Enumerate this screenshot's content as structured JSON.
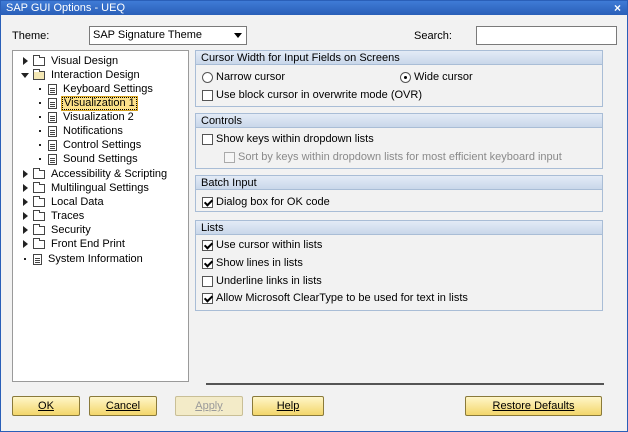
{
  "window": {
    "title": "SAP GUI Options - UEQ",
    "close_glyph": "×"
  },
  "theme": {
    "label": "Theme:",
    "value": "SAP Signature Theme"
  },
  "search": {
    "label": "Search:",
    "value": ""
  },
  "tree": [
    {
      "label": "Visual Design",
      "expander": "right",
      "icon": "folder-icon"
    },
    {
      "label": "Interaction Design",
      "expander": "down",
      "icon": "folder-open-icon"
    },
    {
      "label": "Keyboard Settings",
      "expander": "dot",
      "icon": "page-icon"
    },
    {
      "label": "Visualization 1",
      "expander": "dot",
      "icon": "page-icon",
      "selected": true
    },
    {
      "label": "Visualization 2",
      "expander": "dot",
      "icon": "page-icon"
    },
    {
      "label": "Notifications",
      "expander": "dot",
      "icon": "page-icon"
    },
    {
      "label": "Control Settings",
      "expander": "dot",
      "icon": "page-icon"
    },
    {
      "label": "Sound Settings",
      "expander": "dot",
      "icon": "page-icon"
    },
    {
      "label": "Accessibility & Scripting",
      "expander": "right",
      "icon": "folder-icon"
    },
    {
      "label": "Multilingual Settings",
      "expander": "right",
      "icon": "folder-icon"
    },
    {
      "label": "Local Data",
      "expander": "right",
      "icon": "folder-icon"
    },
    {
      "label": "Traces",
      "expander": "right",
      "icon": "folder-icon"
    },
    {
      "label": "Security",
      "expander": "right",
      "icon": "folder-icon"
    },
    {
      "label": "Front End Print",
      "expander": "right",
      "icon": "folder-icon"
    },
    {
      "label": "System Information",
      "expander": "dot",
      "icon": "page-icon"
    }
  ],
  "cursor_section": {
    "title": "Cursor Width for Input Fields on Screens",
    "narrow": "Narrow cursor",
    "wide": "Wide cursor",
    "selected": "wide",
    "block_cursor": {
      "label": "Use block cursor in overwrite mode (OVR)",
      "checked": false
    }
  },
  "controls_section": {
    "title": "Controls",
    "show_keys": {
      "label": "Show keys within dropdown lists",
      "checked": false
    },
    "sort_keys": {
      "label": "Sort by keys within dropdown lists for most efficient keyboard input",
      "checked": false,
      "enabled": false
    }
  },
  "batch_section": {
    "title": "Batch Input",
    "dialog_box": {
      "label": "Dialog box for OK code",
      "checked": true
    }
  },
  "lists_section": {
    "title": "Lists",
    "use_cursor": {
      "label": "Use cursor within lists",
      "checked": true
    },
    "show_lines": {
      "label": "Show lines in lists",
      "checked": true
    },
    "underline_links": {
      "label": "Underline links in lists",
      "checked": false
    },
    "cleartype": {
      "label": "Allow Microsoft ClearType to be used for text in lists",
      "checked": true
    }
  },
  "buttons": {
    "ok": "OK",
    "cancel": "Cancel",
    "apply": "Apply",
    "help": "Help",
    "restore": "Restore Defaults"
  },
  "colors": {
    "titlebar": "#2a5fb8",
    "button": "#f3d66b",
    "selection": "#fde28a",
    "section_head": "#c9d7ea"
  }
}
